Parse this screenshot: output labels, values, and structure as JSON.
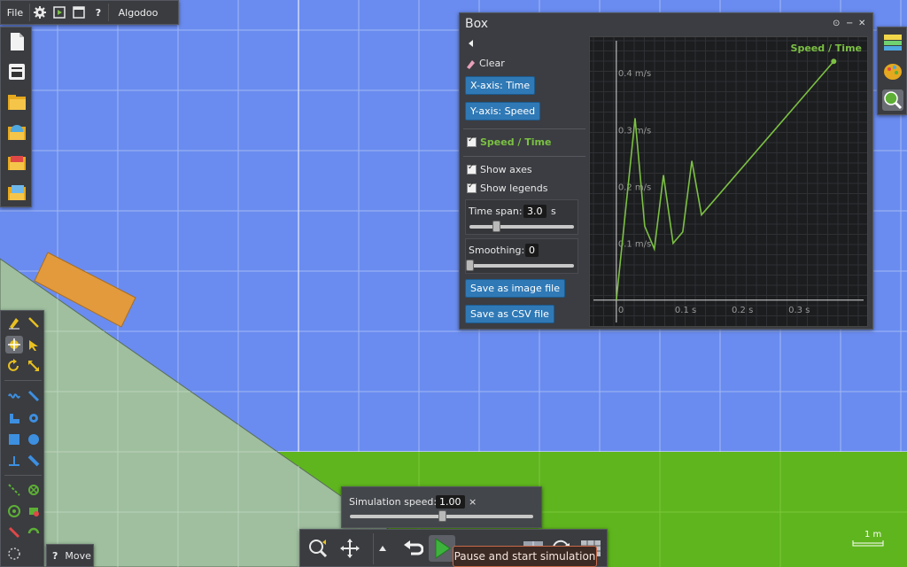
{
  "menu": {
    "file_label": "File",
    "app_label": "Algodoo",
    "help_label": "?"
  },
  "graph_window": {
    "title": "Box",
    "clear_label": "Clear",
    "x_axis_button": "X-axis: Time",
    "y_axis_button": "Y-axis: Speed",
    "series_label": "Speed / Time",
    "show_axes_label": "Show axes",
    "show_legends_label": "Show legends",
    "time_span_label": "Time span:",
    "time_span_value": "3.0",
    "time_span_unit": "s",
    "time_span_slider": 0.25,
    "smoothing_label": "Smoothing:",
    "smoothing_value": "0",
    "smoothing_slider": 0.0,
    "save_image_button": "Save as image file",
    "save_csv_button": "Save as CSV file",
    "series_color": "#7bc043"
  },
  "chart_data": {
    "type": "line",
    "title": "",
    "legend": "Speed / Time",
    "legend_position": "top-right",
    "xlabel": "",
    "ylabel": "",
    "x_ticks": [
      "0",
      "0.1 s",
      "0.2 s",
      "0.3 s"
    ],
    "y_ticks": [
      "0.1 m/s",
      "0.2 m/s",
      "0.3 m/s",
      "0.4 m/s"
    ],
    "xlim": [
      -0.006,
      0.42
    ],
    "ylim": [
      -0.005,
      0.45
    ],
    "grid": true,
    "series": [
      {
        "name": "Speed / Time",
        "x": [
          0.0,
          0.033,
          0.05,
          0.067,
          0.083,
          0.1,
          0.117,
          0.133,
          0.15,
          0.383
        ],
        "y": [
          0.0,
          0.32,
          0.13,
          0.09,
          0.22,
          0.1,
          0.12,
          0.245,
          0.15,
          0.42
        ]
      }
    ]
  },
  "sim_speed": {
    "label": "Simulation speed:",
    "value": "1.00",
    "unit": "×",
    "slider": 0.5
  },
  "tooltip": "Pause and start simulation",
  "move_label": "Move",
  "move_help": "?",
  "scale_label": "1 m",
  "colors": {
    "sky": "#6a8cf0",
    "ground": "#5fb51e",
    "ramp": "#9fbf9f",
    "box": "#e39a3c",
    "series": "#7bc043",
    "tooltip_border": "#c96a4a"
  }
}
